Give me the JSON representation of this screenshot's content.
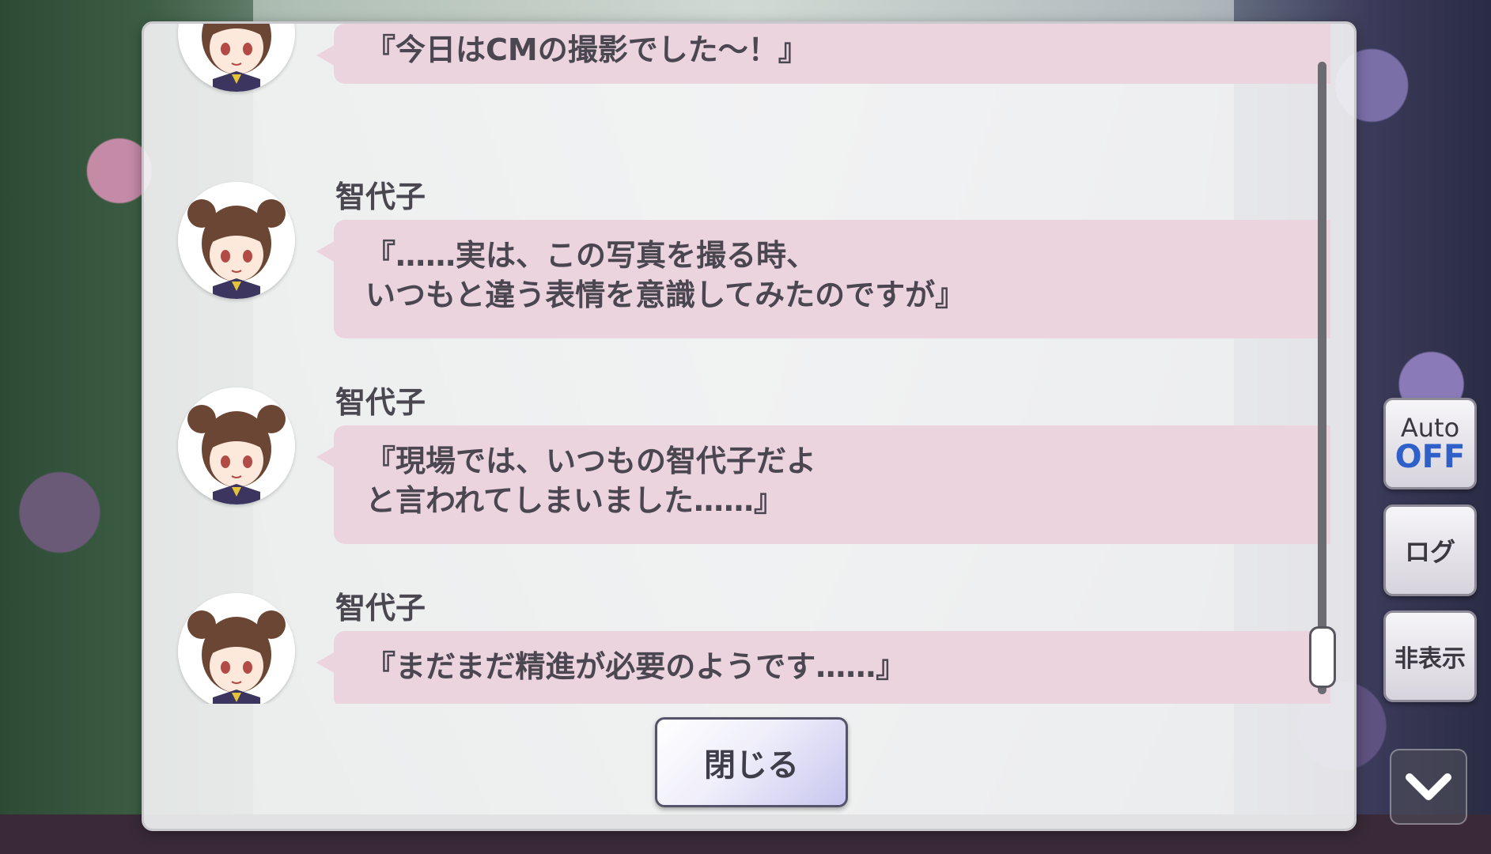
{
  "side_menu": {
    "auto_label": "Auto",
    "auto_state": "OFF",
    "log_label": "ログ",
    "hide_label": "非表示",
    "down_icon": "chevron-down-icon"
  },
  "log_window": {
    "entries": [
      {
        "speaker": "",
        "lines": [
          "『今日はCMの撮影でした～！』"
        ],
        "voice_icon": "speaker-icon"
      },
      {
        "speaker": "智代子",
        "lines": [
          "『……実は、この写真を撮る時、",
          "いつもと違う表情を意識してみたのですが』"
        ],
        "voice_icon": "speaker-icon"
      },
      {
        "speaker": "智代子",
        "lines": [
          "『現場では、いつもの智代子だよ",
          "と言われてしまいました……』"
        ],
        "voice_icon": "speaker-icon"
      },
      {
        "speaker": "智代子",
        "lines": [
          "『まだまだ精進が必要のようです……』"
        ],
        "voice_icon": "speaker-icon"
      }
    ],
    "close_label": "閉じる"
  },
  "colors": {
    "bubble": "#ecd4df",
    "text": "#4a4750",
    "auto_off": "#2f5fc8"
  }
}
